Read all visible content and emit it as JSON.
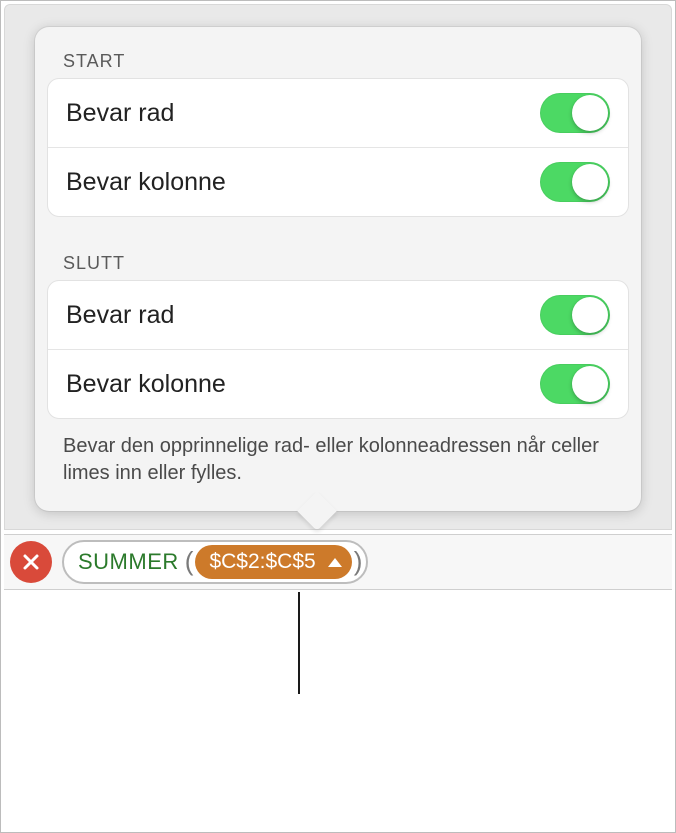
{
  "popover": {
    "start": {
      "title": "START",
      "row1": {
        "label": "Bevar rad",
        "on": true
      },
      "row2": {
        "label": "Bevar kolonne",
        "on": true
      }
    },
    "end": {
      "title": "SLUTT",
      "row1": {
        "label": "Bevar rad",
        "on": true
      },
      "row2": {
        "label": "Bevar kolonne",
        "on": true
      }
    },
    "description": "Bevar den opprinnelige rad- eller kolonneadressen når celler limes inn eller fylles."
  },
  "formula": {
    "function": "SUMMER",
    "reference": "$C$2:$C$5"
  },
  "colors": {
    "switchOn": "#4cd964",
    "tokenBg": "#cd7a2a",
    "closeBtn": "#d94a3a",
    "fnColor": "#2b7a2b"
  }
}
